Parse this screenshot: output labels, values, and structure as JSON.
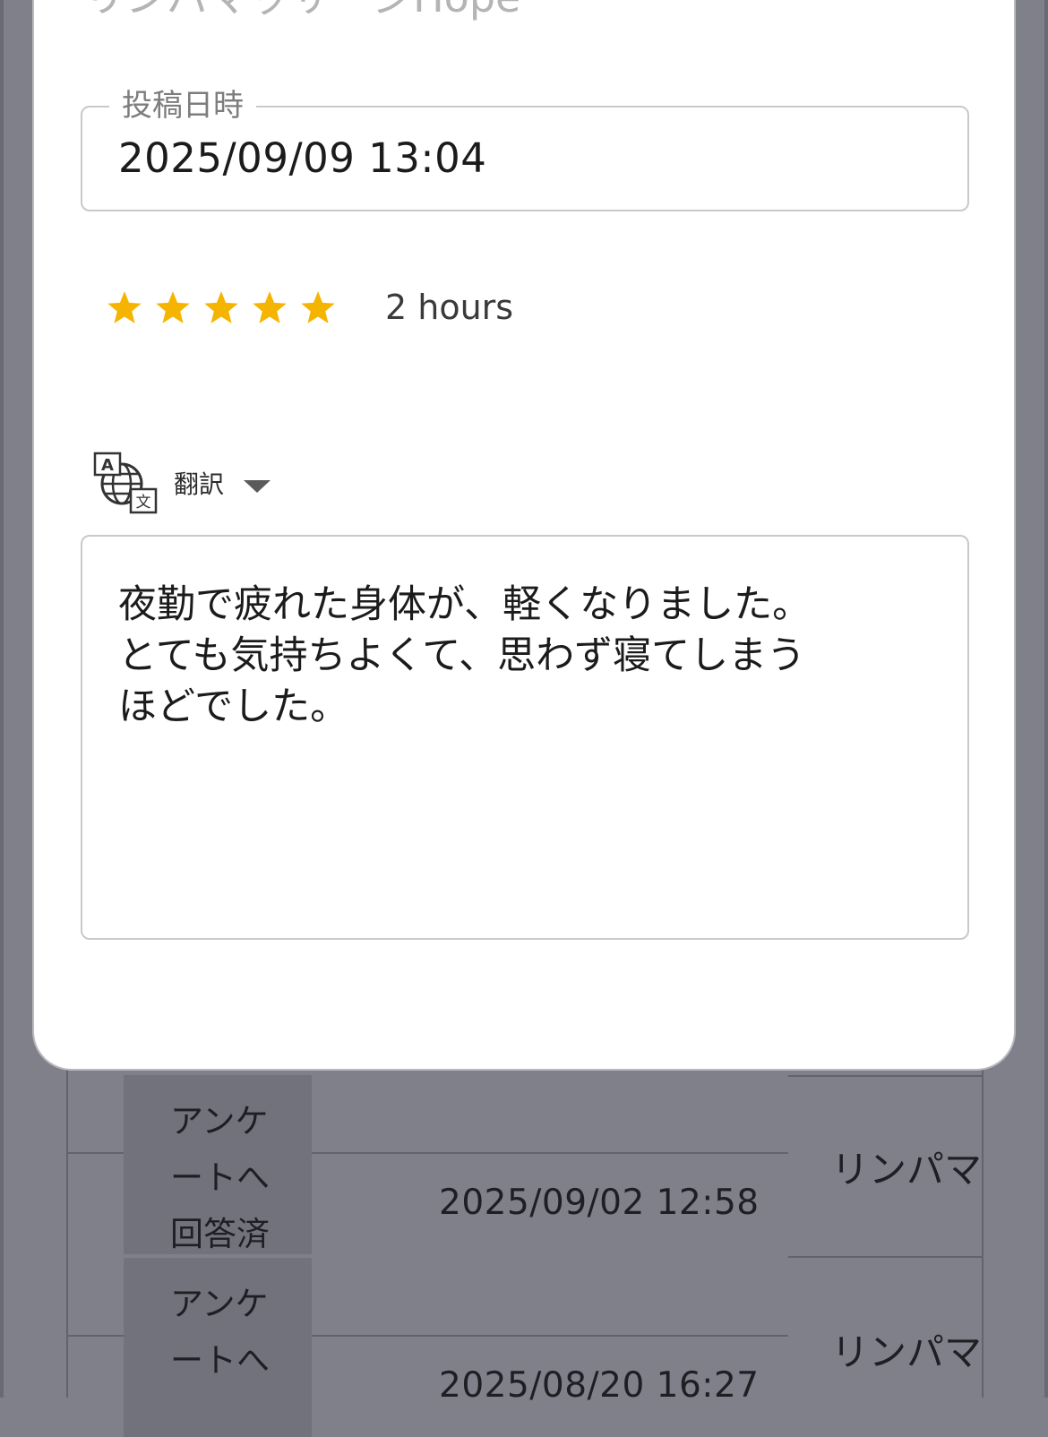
{
  "modal": {
    "shop_title": "リンパマッサージHope",
    "posted_label": "投稿日時",
    "posted_value": "2025/09/09 13:04",
    "rating": {
      "stars": 5,
      "max": 5,
      "color": "#f5b400"
    },
    "time_ago": "2 hours",
    "translate_icon": "translate-icon",
    "translate_label": "翻訳",
    "review_text": "夜勤で疲れた身体が、軽くなりました。\nとても気持ちよくて、思わず寝てしまう\nほどでした。"
  },
  "table": {
    "rows": [
      {
        "status": [
          "アンケ",
          "ートへ",
          "回答済"
        ],
        "date": "2025/09/02 12:58",
        "shop": "リンパマ"
      },
      {
        "status": [
          "アンケ",
          "ートへ"
        ],
        "date": "2025/08/20 16:27",
        "shop": "リンパマ"
      }
    ]
  }
}
